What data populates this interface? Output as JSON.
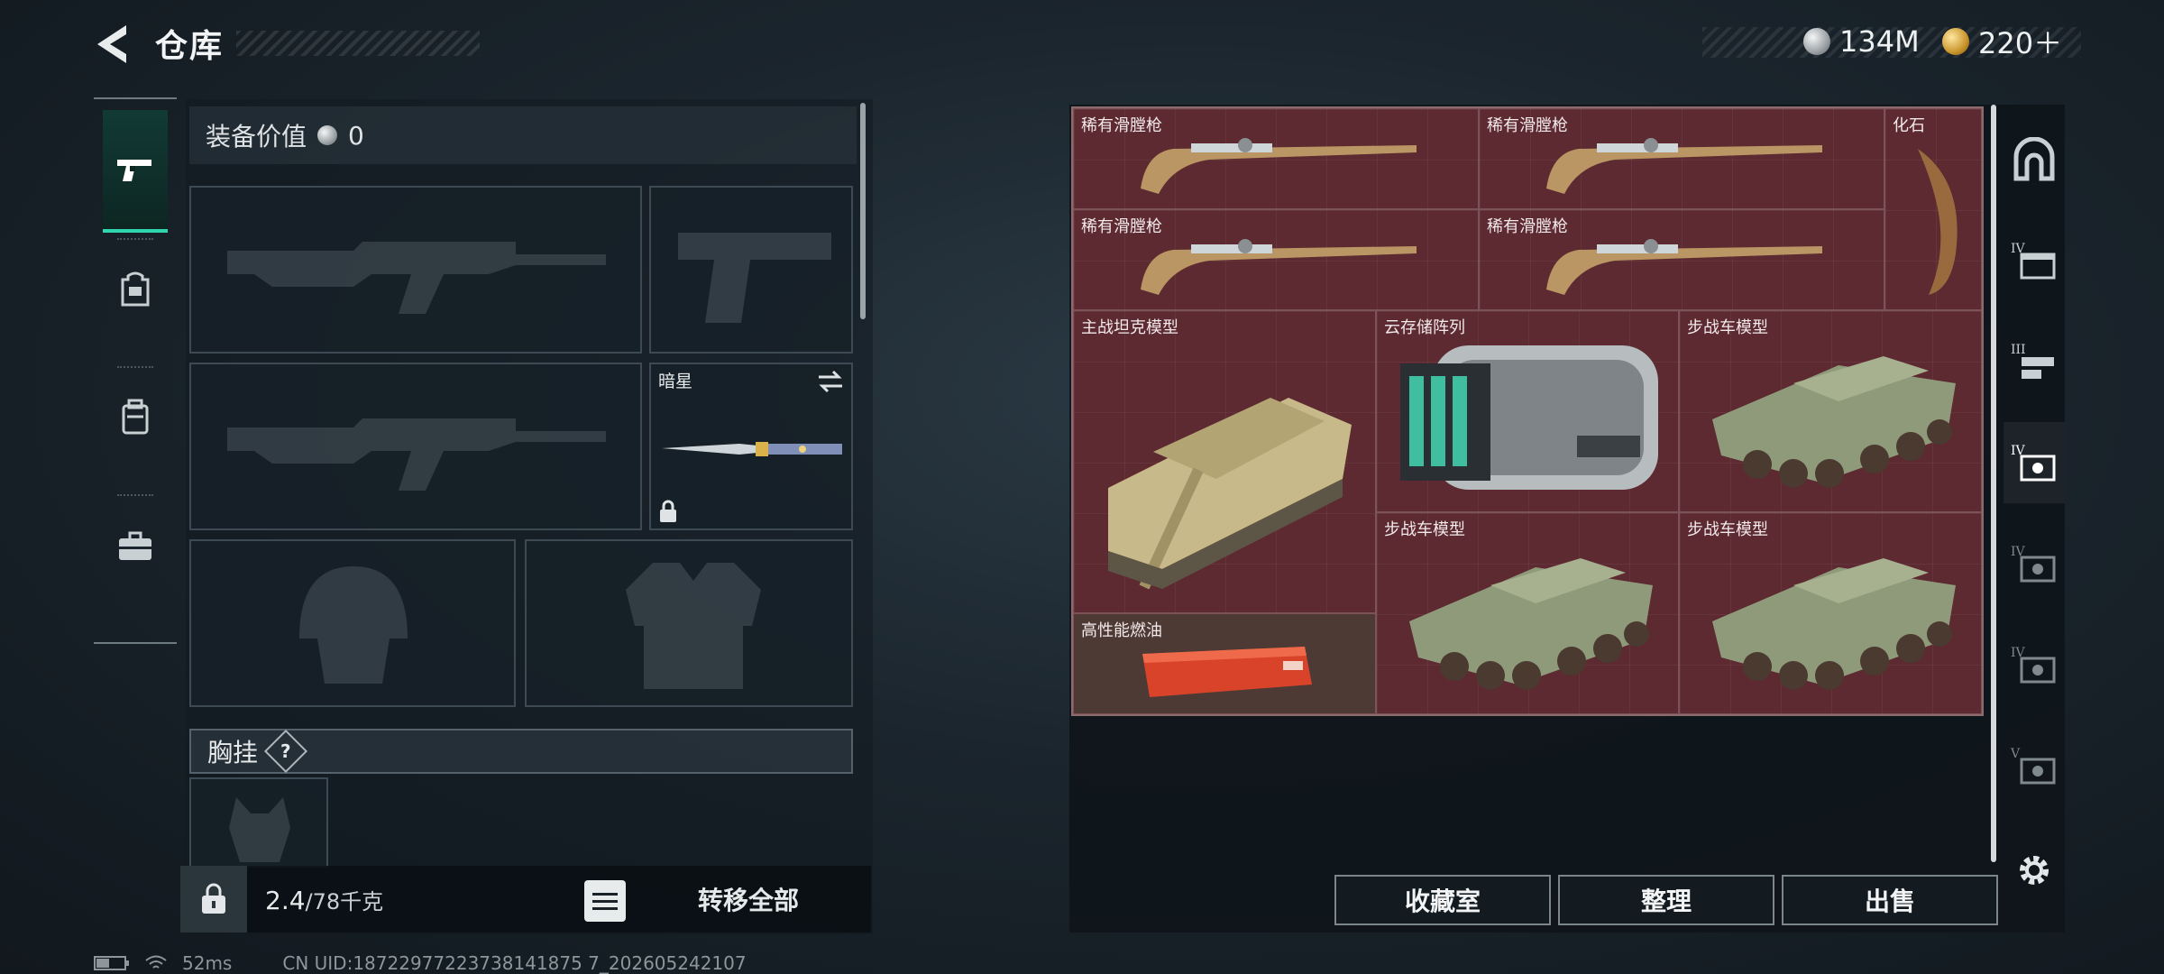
{
  "header": {
    "title": "仓库",
    "currency_1": "134M",
    "currency_2": "220＋"
  },
  "loadout": {
    "equip_value_label": "装备价值",
    "equip_value": "0",
    "knife_slot_label": "暗星",
    "chest_label": "胸挂",
    "help_mark": "?",
    "weight_current": "2.4",
    "weight_max": "/78千克",
    "transfer_all": "转移全部"
  },
  "storage": {
    "items": [
      {
        "label": "稀有滑膛枪"
      },
      {
        "label": "稀有滑膛枪"
      },
      {
        "label": "化石"
      },
      {
        "label": "稀有滑膛枪"
      },
      {
        "label": "稀有滑膛枪"
      },
      {
        "label": "主战坦克模型"
      },
      {
        "label": "云存储阵列"
      },
      {
        "label": "步战车模型"
      },
      {
        "label": "步战车模型"
      },
      {
        "label": "步战车模型"
      },
      {
        "label": "高性能燃油"
      }
    ],
    "side_tabs": [
      "IV",
      "III",
      "IV",
      "IV",
      "IV",
      "V"
    ]
  },
  "actions": {
    "collection": "收藏室",
    "organize": "整理",
    "sell": "出售"
  },
  "status": {
    "ping": "52ms",
    "uid": "CN UID:18722977223738141875 7_202605242107"
  }
}
